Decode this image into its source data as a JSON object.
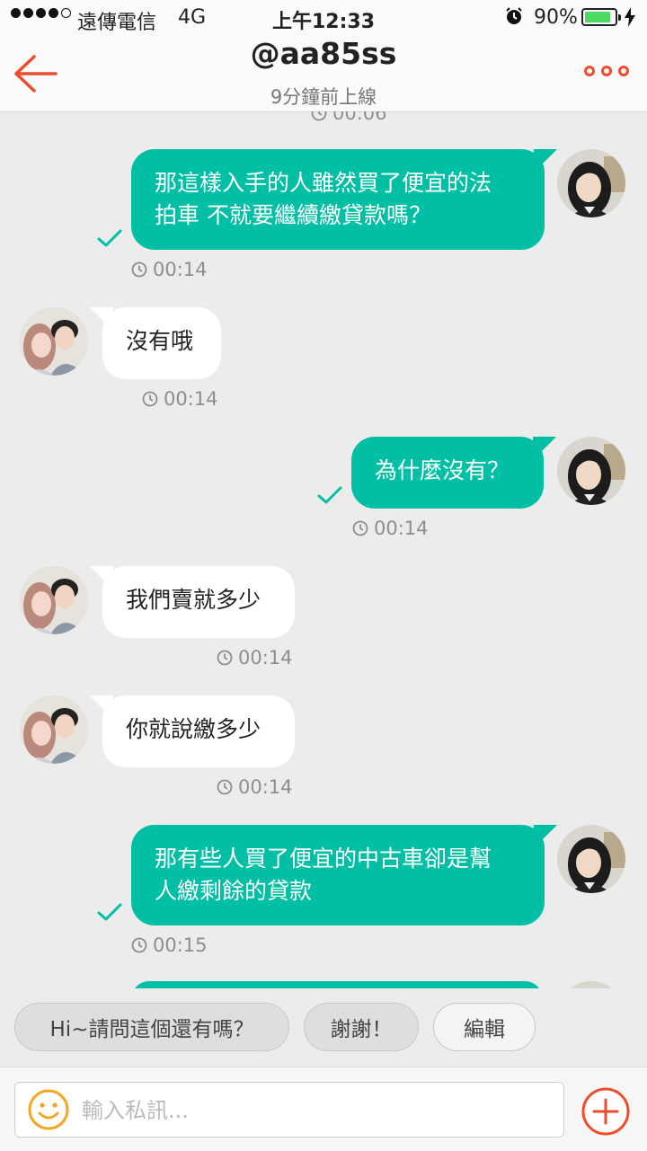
{
  "status_bar": {
    "carrier": "遠傳電信",
    "network": "4G",
    "time": "上午12:33",
    "battery": "90%",
    "battery_level": 0.9
  },
  "header": {
    "title": "@aa85ss",
    "subtitle": "9分鐘前上線",
    "accent_color": "#ee4d2d"
  },
  "messages": [
    {
      "direction": "out",
      "text": "那這樣入手的人雖然買了便宜的法\n拍車 不就要繼續繳貸款嗎？",
      "time": "00:14"
    },
    {
      "direction": "in",
      "text": "沒有哦",
      "time": "00:14"
    },
    {
      "direction": "out",
      "text": "為什麼沒有？",
      "time": "00:14"
    },
    {
      "direction": "in",
      "text": "我們賣就多少",
      "time": "00:14"
    },
    {
      "direction": "in",
      "text": "你就說繳多少",
      "time": "00:14"
    },
    {
      "direction": "out",
      "text": "那有些人買了便宜的中古車卻是幫\n人繳剩餘的貸款",
      "time": "00:15"
    }
  ],
  "partial_top_time": "00:06",
  "quick_replies": [
    "Hi~請問這個還有嗎？",
    "謝謝！"
  ],
  "edit_label": "編輯",
  "input": {
    "placeholder": "輸入私訊..."
  },
  "colors": {
    "bubble_out": "#00bfa5",
    "bubble_in": "#ffffff",
    "background": "#ececec"
  }
}
